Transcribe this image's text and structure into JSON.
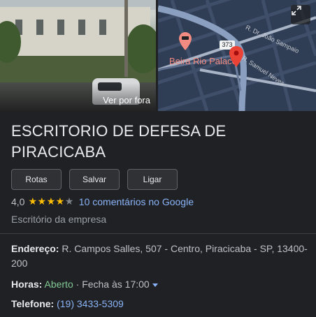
{
  "photo": {
    "caption": "Ver por fora"
  },
  "map": {
    "hotel_label": "Beira Rio Palace",
    "route_shield": "373",
    "streets": [
      "R. Dr. João Sampaio",
      "R. Samuel Neves"
    ],
    "marker_color": "#ea4335",
    "hotel_color": "#f28b82"
  },
  "place": {
    "title": "ESCRITORIO DE DEFESA DE PIRACICABA",
    "actions": [
      "Rotas",
      "Salvar",
      "Ligar"
    ],
    "rating": "4,0",
    "stars_filled": 4,
    "stars_total": 5,
    "reviews_link": "10 comentários no Google",
    "category": "Escritório da empresa"
  },
  "details": {
    "address_label": "Endereço:",
    "address_value": "R. Campos Salles, 507 - Centro, Piracicaba - SP, 13400-200",
    "hours_label": "Horas:",
    "hours_status": "Aberto",
    "hours_separator": "·",
    "hours_close": "Fecha às 17:00",
    "phone_label": "Telefone:",
    "phone_value": "(19) 3433-5309"
  }
}
